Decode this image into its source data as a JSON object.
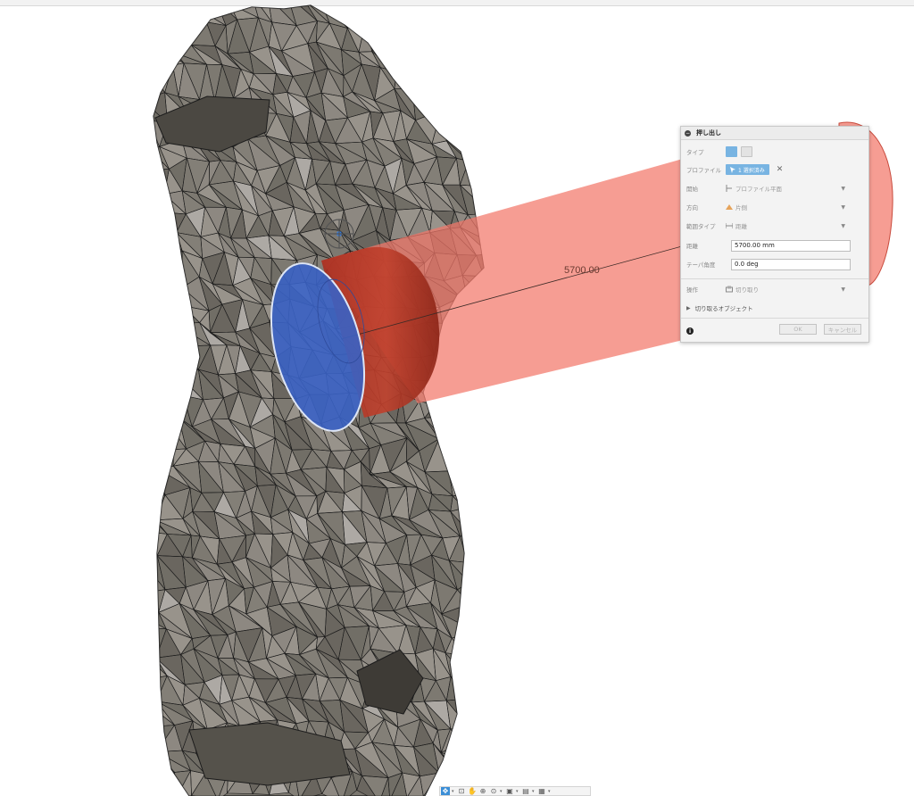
{
  "dialog": {
    "title": "押し出し",
    "type_label": "タイプ",
    "profile_label": "プロファイル",
    "profile_selection": "1 選択済み",
    "start_label": "開始",
    "start_value": "プロファイル平面",
    "direction_label": "方向",
    "direction_value": "片側",
    "extent_label": "範囲タイプ",
    "extent_value": "距離",
    "distance_label": "距離",
    "distance_value": "5700.00 mm",
    "taper_label": "テーパ角度",
    "taper_value": "0.0 deg",
    "operation_label": "操作",
    "operation_value": "切り取り",
    "objects_to_cut": "切り取るオブジェクト",
    "ok_label": "OK",
    "cancel_label": "キャンセル"
  },
  "viewport": {
    "dimension_label": "5700.00"
  },
  "colors": {
    "accent": "#78b4e2",
    "extrude": "#f3776a",
    "profile": "#3a62c4",
    "mesh": "#77746c"
  },
  "nav_icons": [
    "orbit-icon",
    "pan-icon",
    "hand-icon",
    "zoom-fit-icon",
    "zoom-icon",
    "display-icon",
    "grid-icon",
    "viewport-icon"
  ]
}
